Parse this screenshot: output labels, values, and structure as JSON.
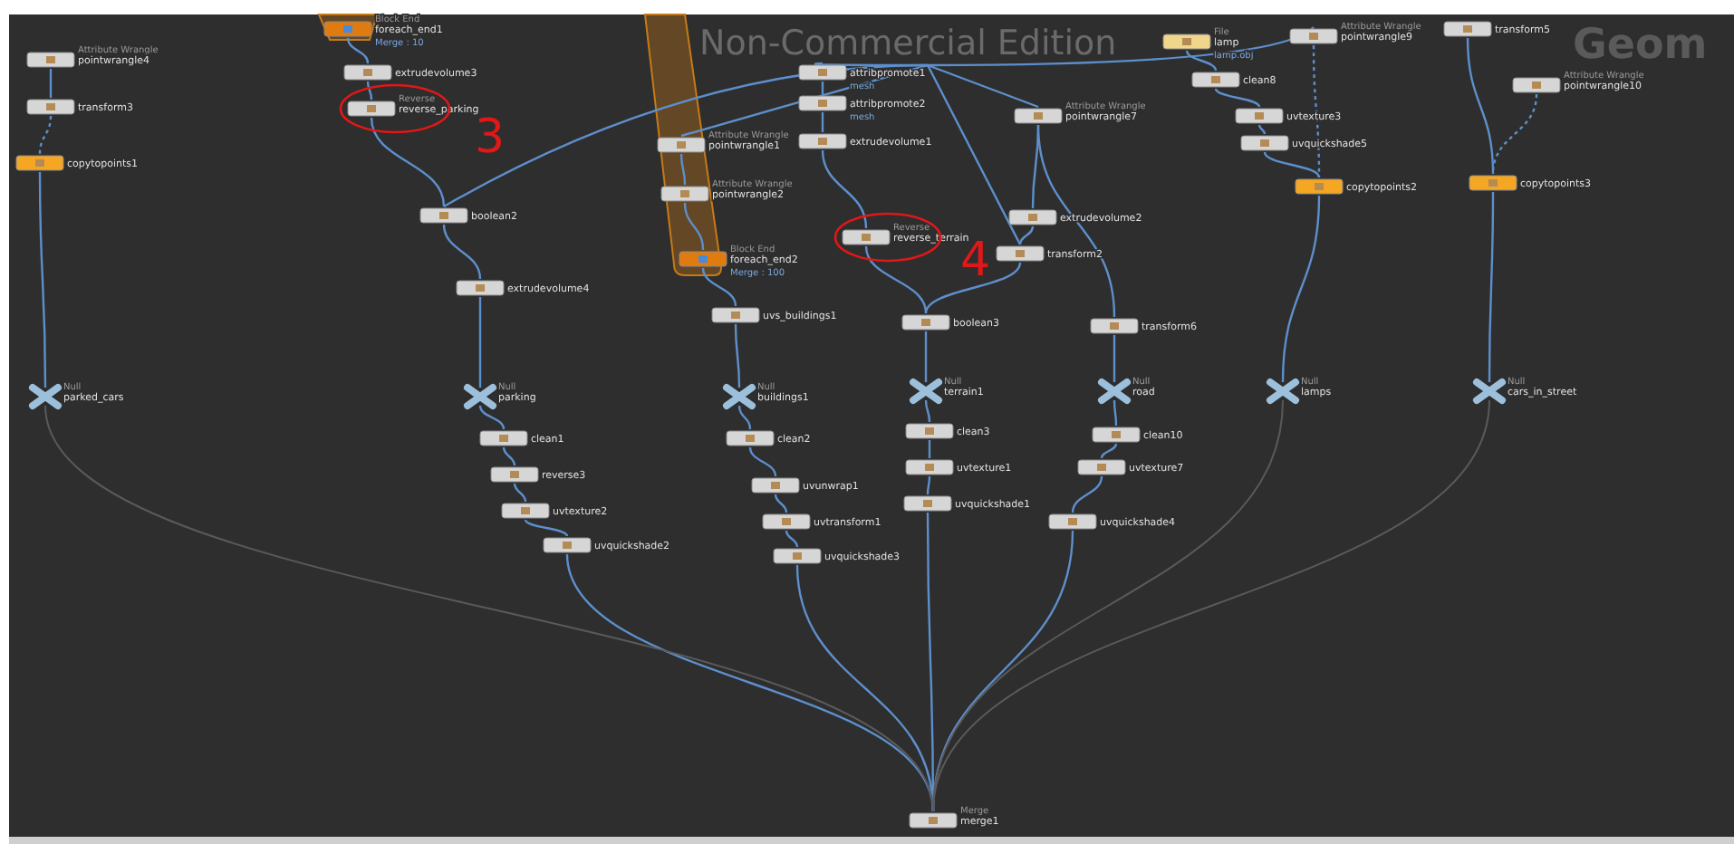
{
  "network": {
    "nodes": [
      {
        "name": "pointwrangle4",
        "type_label": "Attribute Wrangle",
        "kind": "sop"
      },
      {
        "name": "transform3",
        "kind": "sop"
      },
      {
        "name": "copytopoints1",
        "kind": "output"
      },
      {
        "name": "foreach_end1",
        "type_label": "Block End",
        "kind": "block_end",
        "detail": "Merge : 10"
      },
      {
        "name": "extrudevolume3",
        "kind": "sop"
      },
      {
        "name": "reverse_parking",
        "type_label": "Reverse",
        "kind": "sop"
      },
      {
        "name": "boolean2",
        "kind": "sop"
      },
      {
        "name": "extrudevolume4",
        "kind": "sop"
      },
      {
        "name": "parked_cars",
        "type_label": "Null",
        "kind": "null"
      },
      {
        "name": "parking",
        "type_label": "Null",
        "kind": "null"
      },
      {
        "name": "clean1",
        "kind": "sop"
      },
      {
        "name": "reverse3",
        "kind": "sop"
      },
      {
        "name": "uvtexture2",
        "kind": "sop"
      },
      {
        "name": "uvquickshade2",
        "kind": "sop"
      },
      {
        "name": "pointwrangle1",
        "type_label": "Attribute Wrangle",
        "kind": "sop"
      },
      {
        "name": "pointwrangle2",
        "type_label": "Attribute Wrangle",
        "kind": "sop"
      },
      {
        "name": "foreach_end2",
        "type_label": "Block End",
        "kind": "block_end",
        "detail": "Merge : 100"
      },
      {
        "name": "attribpromote1",
        "kind": "sop",
        "detail": "mesh"
      },
      {
        "name": "attribpromote2",
        "kind": "sop",
        "detail": "mesh"
      },
      {
        "name": "extrudevolume1",
        "kind": "sop"
      },
      {
        "name": "reverse_terrain",
        "type_label": "Reverse",
        "kind": "sop"
      },
      {
        "name": "uvs_buildings1",
        "kind": "sop"
      },
      {
        "name": "buildings1",
        "type_label": "Null",
        "kind": "null"
      },
      {
        "name": "clean2",
        "kind": "sop"
      },
      {
        "name": "uvunwrap1",
        "kind": "sop"
      },
      {
        "name": "uvtransform1",
        "kind": "sop"
      },
      {
        "name": "uvquickshade3",
        "kind": "sop"
      },
      {
        "name": "pointwrangle7",
        "type_label": "Attribute Wrangle",
        "kind": "sop"
      },
      {
        "name": "extrudevolume2",
        "kind": "sop"
      },
      {
        "name": "transform2",
        "kind": "sop"
      },
      {
        "name": "boolean3",
        "kind": "sop"
      },
      {
        "name": "terrain1",
        "type_label": "Null",
        "kind": "null"
      },
      {
        "name": "clean3",
        "kind": "sop"
      },
      {
        "name": "uvtexture1",
        "kind": "sop"
      },
      {
        "name": "uvquickshade1",
        "kind": "sop"
      },
      {
        "name": "transform6",
        "kind": "sop"
      },
      {
        "name": "road",
        "type_label": "Null",
        "kind": "null"
      },
      {
        "name": "clean10",
        "kind": "sop"
      },
      {
        "name": "uvtexture7",
        "kind": "sop"
      },
      {
        "name": "uvquickshade4",
        "kind": "sop"
      },
      {
        "name": "lamp",
        "type_label": "File",
        "kind": "file",
        "detail": "lamp.obj"
      },
      {
        "name": "clean8",
        "kind": "sop"
      },
      {
        "name": "uvtexture3",
        "kind": "sop"
      },
      {
        "name": "uvquickshade5",
        "kind": "sop"
      },
      {
        "name": "pointwrangle9",
        "type_label": "Attribute Wrangle",
        "kind": "sop"
      },
      {
        "name": "copytopoints2",
        "kind": "output"
      },
      {
        "name": "transform5",
        "kind": "sop"
      },
      {
        "name": "pointwrangle10",
        "type_label": "Attribute Wrangle",
        "kind": "sop"
      },
      {
        "name": "copytopoints3",
        "kind": "output"
      },
      {
        "name": "lamps",
        "type_label": "Null",
        "kind": "null"
      },
      {
        "name": "cars_in_street",
        "type_label": "Null",
        "kind": "null"
      },
      {
        "name": "merge1",
        "type_label": "Merge",
        "kind": "sop"
      }
    ]
  },
  "overlay": {
    "edition": "Non-Commercial Edition",
    "context": "Geom"
  },
  "annotations": [
    {
      "text": "3"
    },
    {
      "text": "4"
    }
  ]
}
